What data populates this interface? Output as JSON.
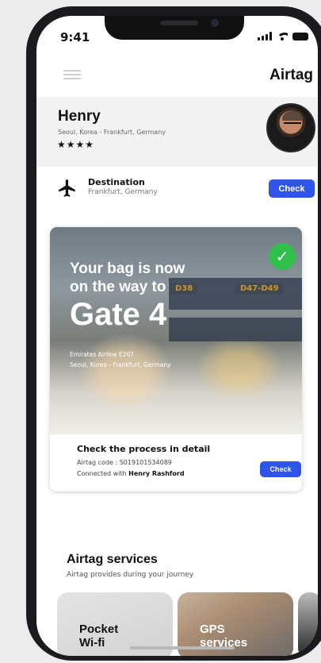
{
  "status": {
    "time": "9:41"
  },
  "header": {
    "title": "Airtag"
  },
  "user": {
    "name": "Henry",
    "route": "Seoul, Korea - Frankfurt, Germany",
    "rating": "★★★★"
  },
  "destination": {
    "label": "Destination",
    "value": "Frankfurt, Germany",
    "button": "Check"
  },
  "bag": {
    "line1": "Your bag is now",
    "line2": "on the way to",
    "gate": "Gate 4",
    "airline": "Emirates Airline E207",
    "route": "Seoul, Korea - Frankfurt, Germany",
    "signs": [
      "D38",
      "D47-D49"
    ],
    "detail_title": "Check the process in detail",
    "code": "Airtag code : S019101534089",
    "connected_prefix": "Connected with ",
    "connected_name": "Henry Rashford",
    "button": "Check"
  },
  "services": {
    "title": "Airtag services",
    "subtitle": "Airtag provides during your journey",
    "items": [
      {
        "line1": "Pocket",
        "line2": "Wi-fi"
      },
      {
        "line1": "GPS",
        "line2": "services"
      }
    ]
  },
  "colors": {
    "accent": "#2f54eb",
    "success": "#2fbf4a"
  },
  "icons": [
    "menu-icon",
    "plane-icon",
    "check-icon",
    "signal-icon",
    "wifi-icon",
    "battery-icon"
  ]
}
